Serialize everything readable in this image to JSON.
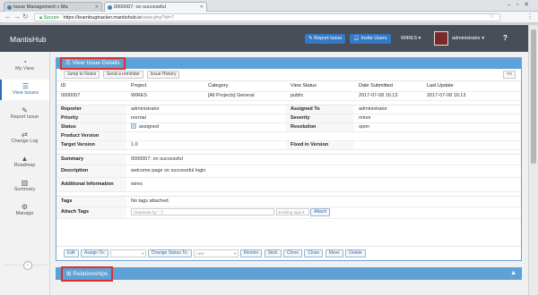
{
  "browser": {
    "tabs": [
      {
        "label": "Issue Management » Ma"
      },
      {
        "label": "0000007: on successful"
      }
    ],
    "secure_label": "Secure",
    "url_host": "https://learnbugtracker.mantishub.io",
    "url_path": "/view.php?id=7"
  },
  "app": {
    "brand": "MantisHub",
    "report_issue": "Report Issue",
    "invite_users": "Invite Users",
    "project": "WIRES",
    "user": "administrator"
  },
  "sidebar": {
    "items": [
      {
        "label": "My View",
        "icon": "dashboard-icon"
      },
      {
        "label": "View Issues",
        "icon": "list-icon"
      },
      {
        "label": "Report Issue",
        "icon": "edit-icon"
      },
      {
        "label": "Change Log",
        "icon": "retweet-icon"
      },
      {
        "label": "Roadmap",
        "icon": "road-icon"
      },
      {
        "label": "Summary",
        "icon": "bar-chart-icon"
      },
      {
        "label": "Manage",
        "icon": "gears-icon"
      }
    ]
  },
  "panel": {
    "title": "View Issue Details",
    "buttons": [
      "Jump to Notes",
      "Send a reminder",
      "Issue History"
    ],
    "headers": [
      "ID",
      "Project",
      "Category",
      "View Status",
      "Date Submitted",
      "Last Update"
    ],
    "values": [
      "0000007",
      "WIRES",
      "[All Projects] General",
      "public",
      "2017-07-08 16:13",
      "2017-07-08 16:13"
    ],
    "reporter_label": "Reporter",
    "reporter": "administrator",
    "assigned_label": "Assigned To",
    "assigned": "administrator",
    "priority_label": "Priority",
    "priority": "normal",
    "severity_label": "Severity",
    "severity": "minor",
    "status_label": "Status",
    "status": "assigned",
    "resolution_label": "Resolution",
    "resolution": "open",
    "product_version_label": "Product Version",
    "target_version_label": "Target Version",
    "target_version": "1.0",
    "fixed_version_label": "Fixed in Version",
    "summary_label": "Summary",
    "summary": "0000007: on successful",
    "description_label": "Description",
    "description": "welcome page on successful login",
    "additional_label": "Additional Information",
    "additional": "wires",
    "tags_label": "Tags",
    "tags": "No tags attached.",
    "attach_label": "Attach Tags",
    "attach_placeholder": "(Separate by \",\")",
    "existing_tags": "Existing tags",
    "attach_button": "Attach"
  },
  "actions": {
    "edit": "Edit",
    "assign_to": "Assign To:",
    "change_status": "Change Status To:",
    "status_option": "new",
    "monitor": "Monitor",
    "stick": "Stick",
    "clone": "Clone",
    "close": "Close",
    "move": "Move",
    "delete": "Delete"
  },
  "relationships": {
    "title": "Relationships"
  }
}
